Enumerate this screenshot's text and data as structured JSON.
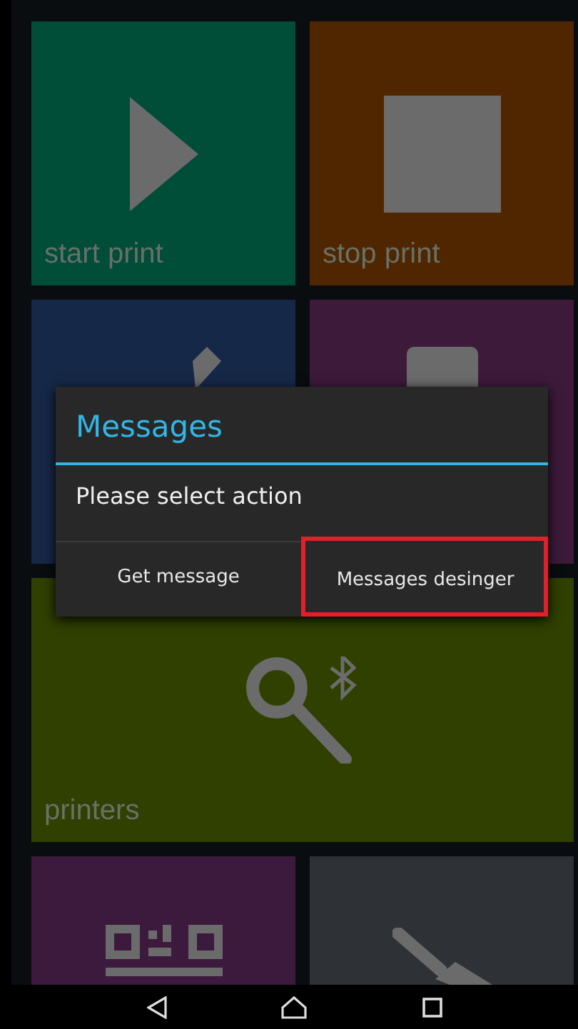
{
  "tiles": [
    {
      "kind": "play",
      "label": "start print",
      "color": "#004d38",
      "wide": false
    },
    {
      "kind": "stop",
      "label": "stop print",
      "color": "#4f2600",
      "wide": false
    },
    {
      "kind": "edit",
      "color": "#162848",
      "wide": false
    },
    {
      "kind": "printer",
      "color": "#3d1a3a",
      "wide": false
    },
    {
      "kind": "bluetooth-search",
      "label": "printers",
      "color": "#2f4000",
      "wide": true
    },
    {
      "kind": "qr",
      "color": "#3b1a3d",
      "wide": false
    },
    {
      "kind": "brush",
      "color": "#2e3236",
      "wide": false
    }
  ],
  "dialog": {
    "title": "Messages",
    "message": "Please select action",
    "buttons": [
      {
        "label": "Get message",
        "highlighted": false
      },
      {
        "label": "Messages desinger",
        "highlighted": true
      }
    ]
  }
}
